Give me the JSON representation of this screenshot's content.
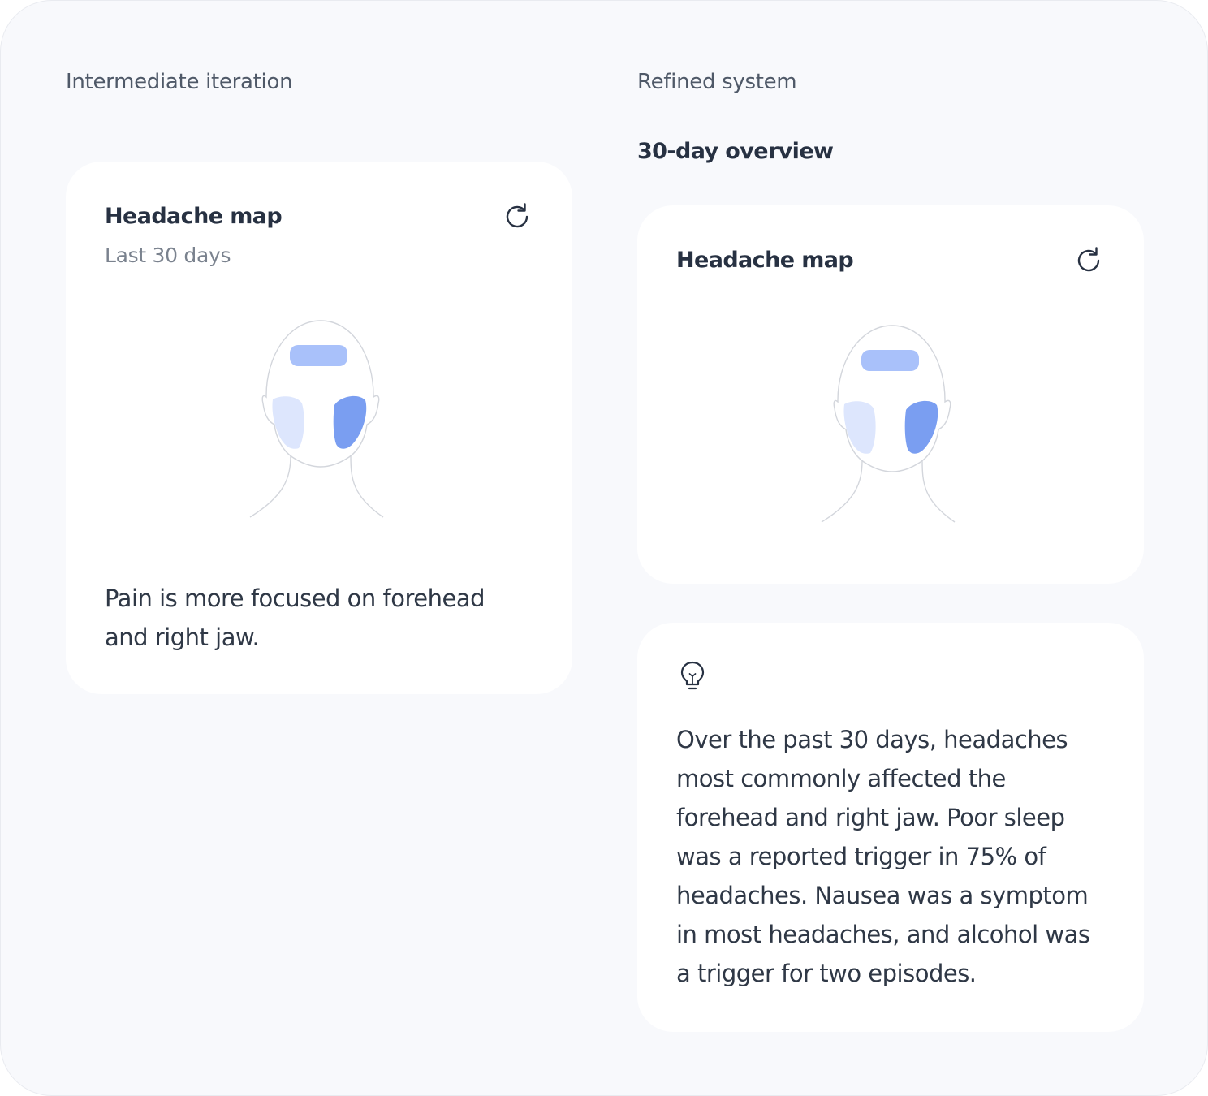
{
  "left": {
    "section_label": "Intermediate iteration",
    "card": {
      "title": "Headache map",
      "subtitle": "Last 30 days",
      "summary": "Pain is more focused on forehead and right jaw."
    }
  },
  "right": {
    "section_label": "Refined system",
    "sub_heading": "30-day overview",
    "map_card": {
      "title": "Headache map"
    },
    "insight_card": {
      "text": "Over the past 30 days, headaches most commonly affected the forehead and right jaw. Poor sleep was a reported trigger in 75% of headaches. Nausea was a symptom in most headaches, and alcohol was a trigger for two episodes."
    }
  },
  "icons": {
    "refresh": "refresh-icon",
    "lightbulb": "lightbulb-icon",
    "head": "head-diagram"
  },
  "colors": {
    "background": "#f8f9fc",
    "card": "#ffffff",
    "pain_forehead": "#a9c1fa",
    "pain_left_jaw": "#dde6fd",
    "pain_right_jaw": "#7a9ef1",
    "text_dark": "#273142",
    "text_muted": "#7a828e"
  }
}
